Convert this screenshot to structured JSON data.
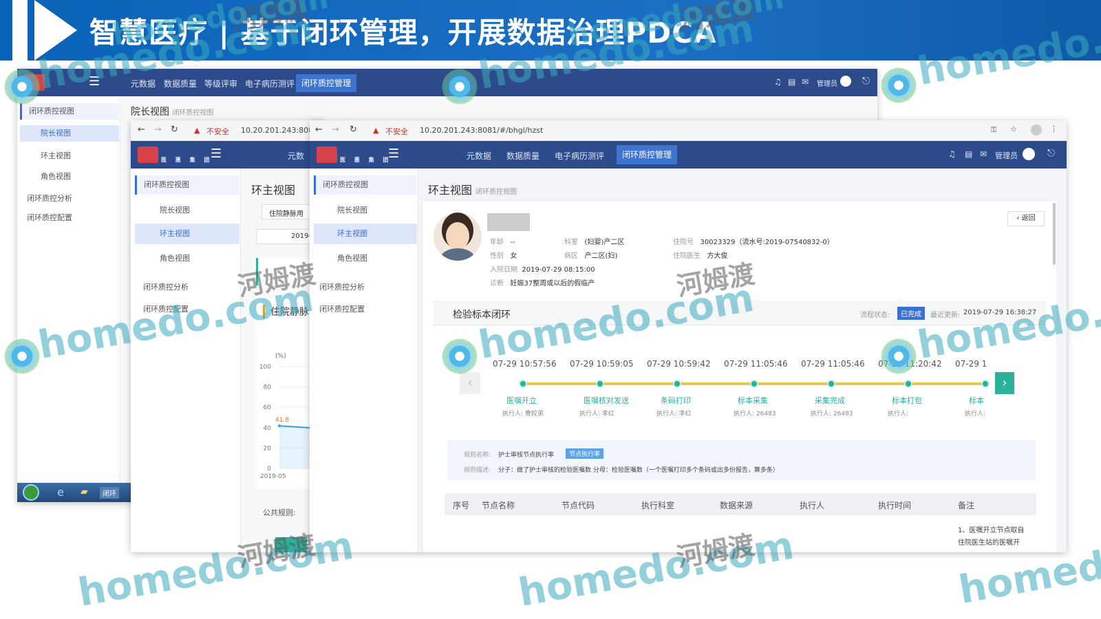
{
  "slide": {
    "title": "智慧医疗 | 基于闭环管理，开展数据治理PDCA"
  },
  "win1": {
    "menu": [
      "元数据",
      "数据质量",
      "等级评审",
      "电子病历测评",
      "闭环质控管理"
    ],
    "user": "管理员",
    "sidebar": {
      "group1": "闭环质控视图",
      "items": [
        "院长视图",
        "环主视图",
        "角色视图"
      ],
      "group2": "闭环质控分析",
      "group3": "闭环质控配置"
    },
    "breadcrumb_title": "院长视图",
    "breadcrumb_sub": "闭环质控视图"
  },
  "win2": {
    "address_insecure": "不安全",
    "address": "10.20.201.243:808",
    "logo_text": "医 惠 集 团",
    "menu_first": "元数",
    "sidebar": {
      "group1": "闭环质控视图",
      "items": [
        "院长视图",
        "环主视图",
        "角色视图"
      ],
      "group2": "闭环质控分析",
      "group3": "闭环质控配置"
    },
    "page_title": "环主视图",
    "filter": "住院静脉用",
    "date": "2019-",
    "card_title": "住院静脉",
    "chart_unit": "(%)",
    "rule_label": "公共规则:"
  },
  "chart_data": {
    "type": "line",
    "categories": [
      "2019-05"
    ],
    "values": [
      41.8
    ],
    "title": "",
    "xlabel": "",
    "ylabel": "(%)",
    "ylim": [
      0,
      100
    ],
    "yticks": [
      "100",
      "80",
      "60",
      "40",
      "20",
      "0"
    ],
    "data_label": "41.8"
  },
  "win3": {
    "address_insecure": "不安全",
    "address": "10.20.201.243:8081/#/bhgl/hzst",
    "logo_text": "医 惠 集 团",
    "menu": [
      "元数据",
      "数据质量",
      "电子病历测评",
      "闭环质控管理"
    ],
    "user": "管理员",
    "sidebar": {
      "group1": "闭环质控视图",
      "items": [
        "院长视图",
        "环主视图",
        "角色视图"
      ],
      "group2": "闭环质控分析",
      "group3": "闭环质控配置"
    },
    "page_title": "环主视图",
    "page_sub": "闭环质控视图",
    "back": "‹ 返回",
    "patient": {
      "age_label": "年龄",
      "age": "--",
      "gender_label": "性别",
      "gender": "女",
      "dept_label": "科室",
      "dept": "(妇婴)产二区",
      "ward_label": "病区",
      "ward": "产二区(妇)",
      "admit_no_label": "住院号",
      "admit_no": "30023329（流水号:2019-07540832-0）",
      "doctor_label": "住院医生",
      "doctor": "方大俊",
      "admit_date_label": "入院日期",
      "admit_date": "2019-07-29 08:15:00",
      "diag_label": "诊断",
      "diag": "妊娠37整周或以后的假临产"
    },
    "loop": {
      "title": "检验标本闭环",
      "status_label": "流程状态:",
      "status": "已完成",
      "update_label": "最近更新:",
      "update": "2019-07-29 16:38:27",
      "nodes": [
        {
          "time": "07-29 10:57:56",
          "name": "医嘱开立",
          "exec_label": "执行人:",
          "exec": "曹姣弟"
        },
        {
          "time": "07-29 10:59:05",
          "name": "医嘱核对发送",
          "exec_label": "执行人:",
          "exec": "李红"
        },
        {
          "time": "07-29 10:59:42",
          "name": "条码打印",
          "exec_label": "执行人:",
          "exec": "李红"
        },
        {
          "time": "07-29 11:05:46",
          "name": "标本采集",
          "exec_label": "执行人:",
          "exec": "26483"
        },
        {
          "time": "07-29 11:05:46",
          "name": "采集完成",
          "exec_label": "执行人:",
          "exec": "26483"
        },
        {
          "time": "07-29 11:20:42",
          "name": "标本打包",
          "exec_label": "执行人:",
          "exec": ""
        },
        {
          "time": "07-29 1",
          "name": "标本",
          "exec_label": "执行人:",
          "exec": ""
        }
      ],
      "rule_name_label": "规则名称:",
      "rule_name": "护士审核节点执行率",
      "rule_tag": "节点执行率",
      "rule_desc_label": "规则描述:",
      "rule_desc": "分子：做了护士审核的检验医嘱数 分母：检验医嘱数（一个医嘱打印多个条码或出多份报告，算多条）"
    },
    "table": {
      "headers": [
        "序号",
        "节点名称",
        "节点代码",
        "执行科室",
        "数据来源",
        "执行人",
        "执行时间",
        "备注"
      ],
      "note": [
        "1、医嘱开立节点取自",
        "住院医生站的医嘱开"
      ]
    }
  },
  "taskbar": {
    "item": "闭环"
  },
  "watermark": {
    "latin": "homedo.com",
    "cn": "河姆渡"
  }
}
